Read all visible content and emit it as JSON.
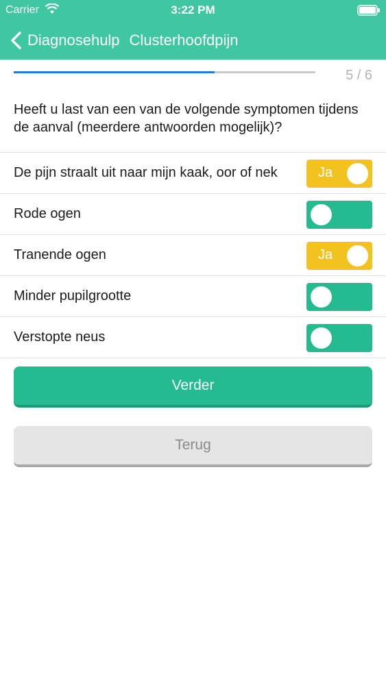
{
  "status_bar": {
    "carrier": "Carrier",
    "time": "3:22 PM"
  },
  "nav": {
    "back_label": "Diagnosehulp",
    "title": "Clusterhoofdpijn"
  },
  "progress": {
    "text": "5 / 6",
    "fraction": 0.667
  },
  "question": "Heeft u last van een van de volgende symptomen tijdens de aanval (meerdere antwoorden mogelijk)?",
  "options": [
    {
      "label": "De pijn straalt uit naar mijn kaak, oor of nek",
      "toggle_on": true,
      "toggle_text": "Ja"
    },
    {
      "label": "Rode ogen",
      "toggle_on": false,
      "toggle_text": ""
    },
    {
      "label": "Tranende ogen",
      "toggle_on": true,
      "toggle_text": "Ja"
    },
    {
      "label": "Minder pupilgrootte",
      "toggle_on": false,
      "toggle_text": ""
    },
    {
      "label": "Verstopte neus",
      "toggle_on": false,
      "toggle_text": ""
    }
  ],
  "buttons": {
    "next": "Verder",
    "back": "Terug"
  },
  "colors": {
    "header": "#3ec7a1",
    "toggle_on": "#f2c31f",
    "toggle_off": "#25bb91",
    "progress": "#1f7ae0"
  }
}
